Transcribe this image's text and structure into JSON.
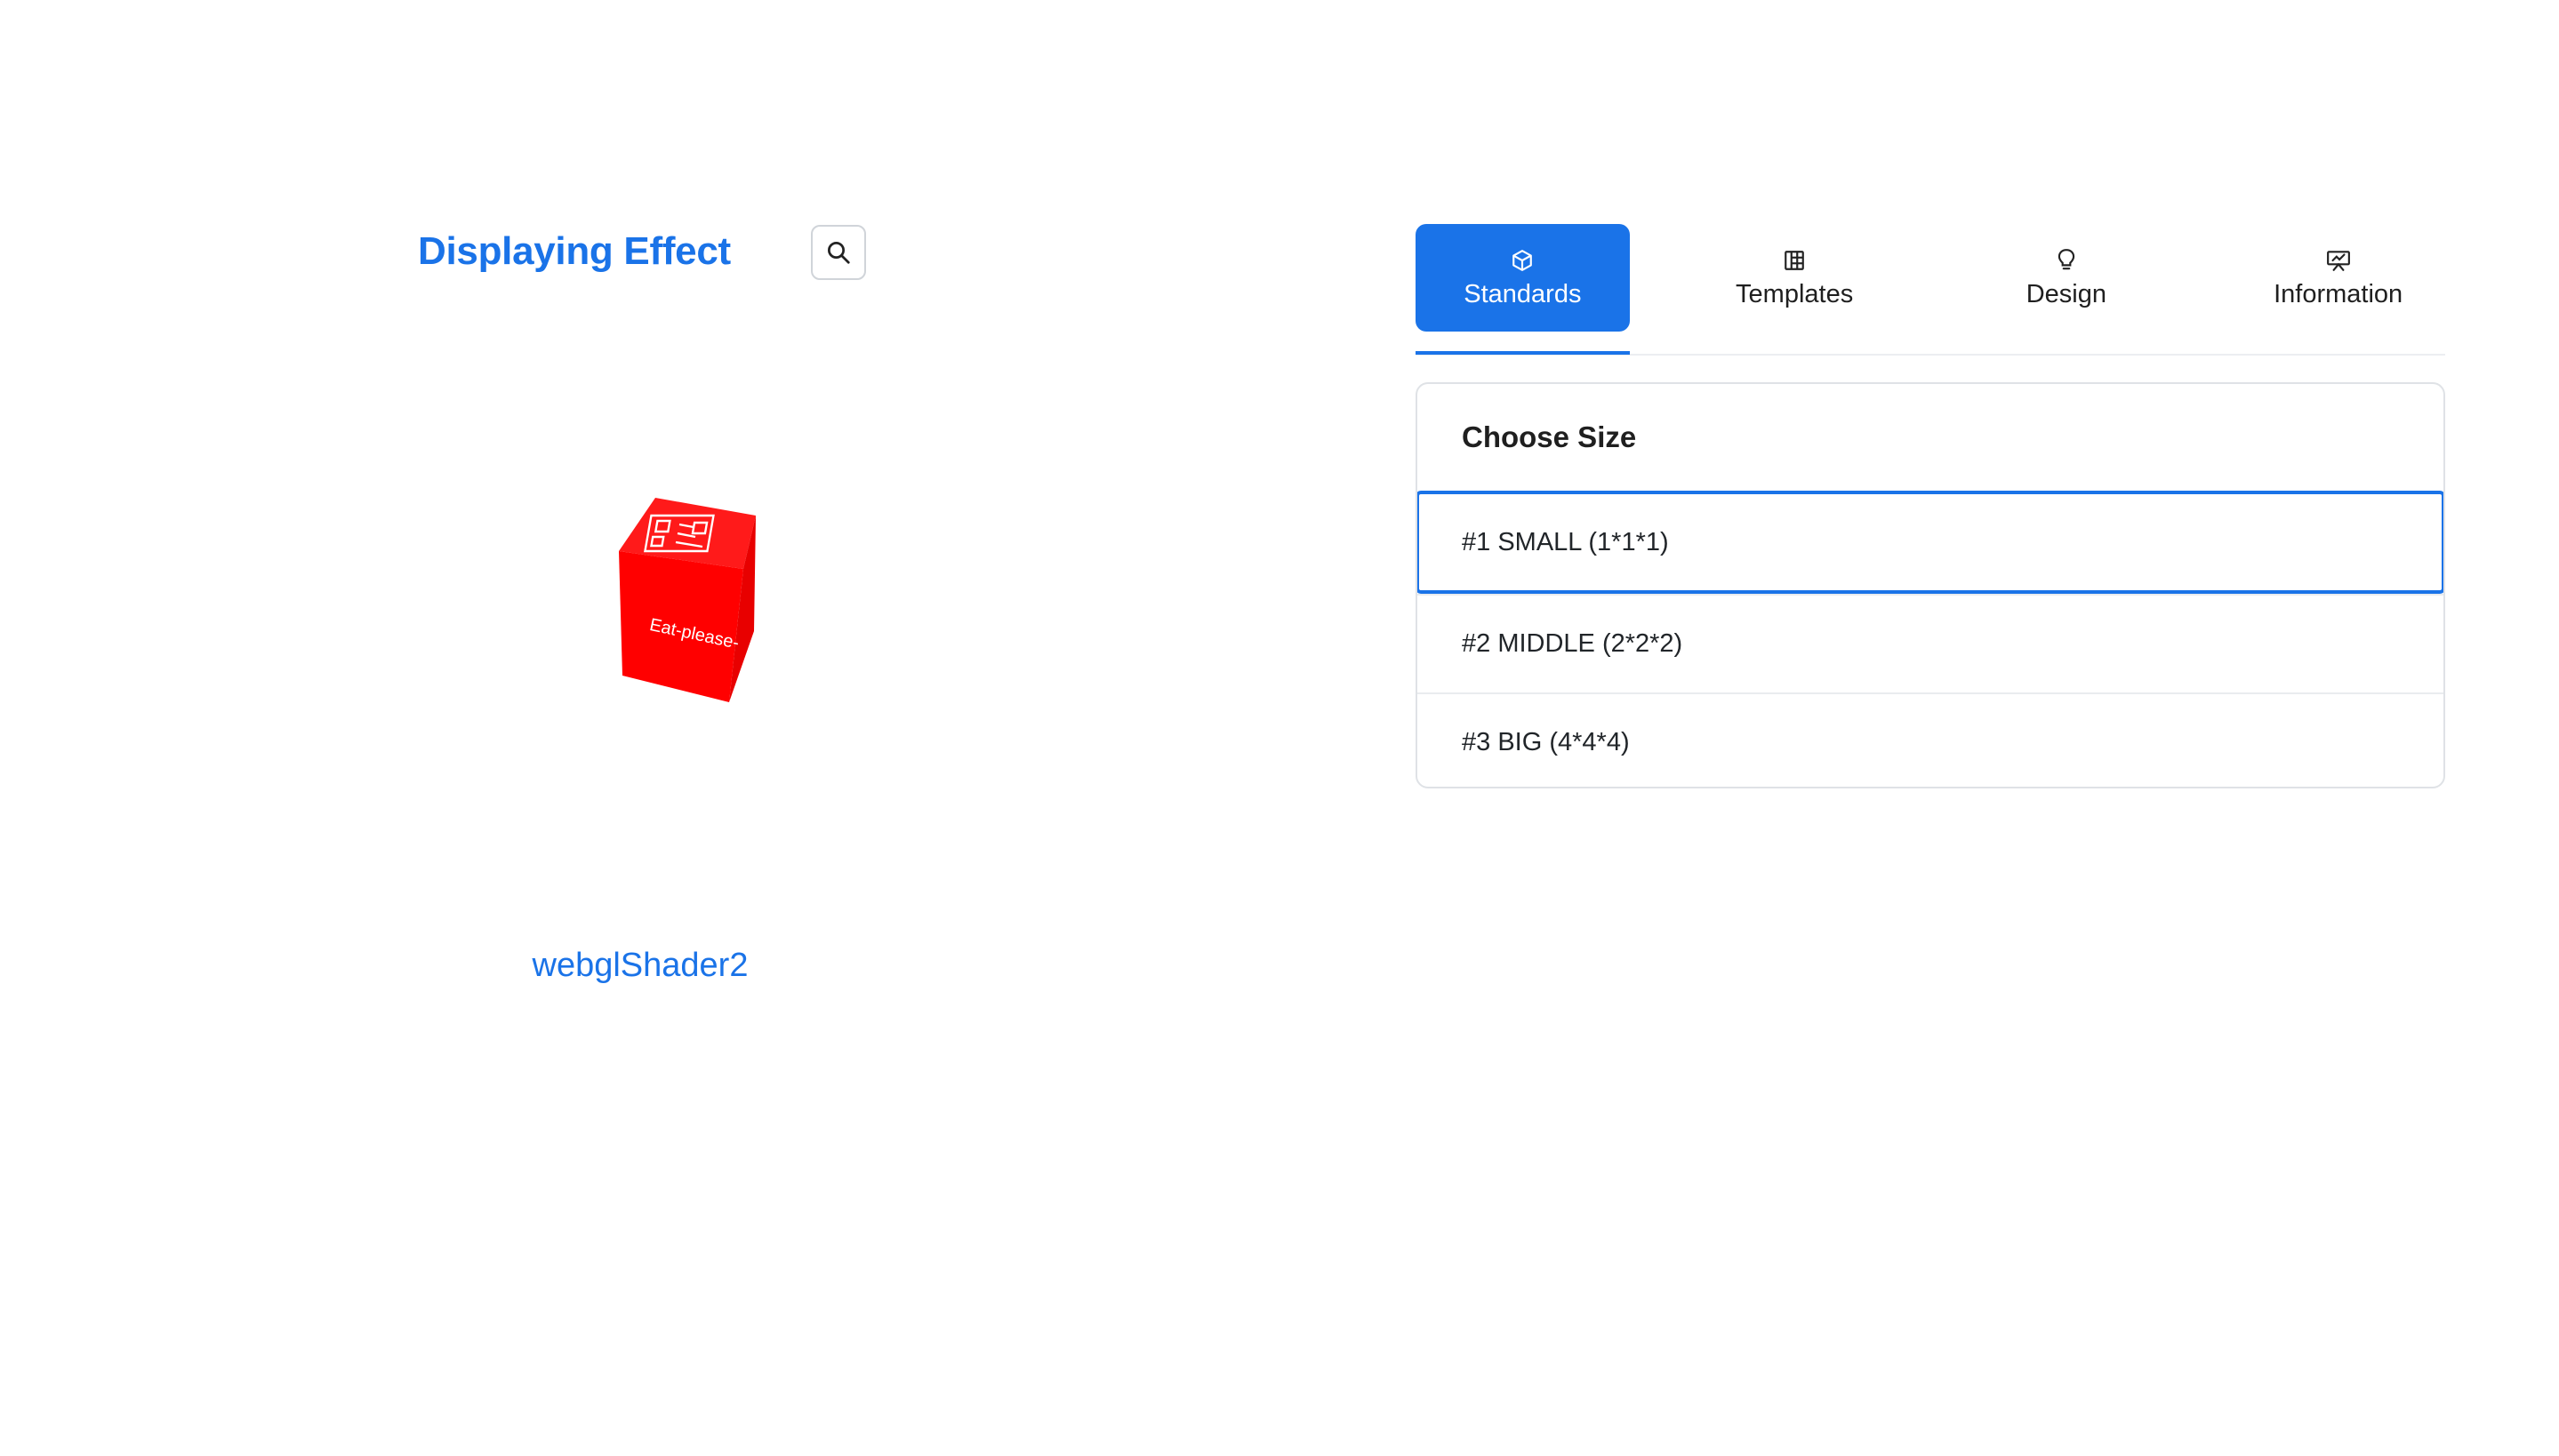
{
  "left_panel": {
    "title": "Displaying Effect",
    "search_icon": "search-icon",
    "cube_front_text": "Eat-please-",
    "caption": "webglShader2",
    "cube_color": "#ff0000"
  },
  "tabs": [
    {
      "label": "Standards",
      "icon": "cube-icon",
      "active": true
    },
    {
      "label": "Templates",
      "icon": "grid-icon",
      "active": false
    },
    {
      "label": "Design",
      "icon": "lightbulb-icon",
      "active": false
    },
    {
      "label": "Information",
      "icon": "presentation-icon",
      "active": false
    }
  ],
  "size_card": {
    "header": "Choose Size",
    "options": [
      {
        "label": "#1 SMALL (1*1*1)",
        "selected": true
      },
      {
        "label": "#2 MIDDLE (2*2*2)",
        "selected": false
      },
      {
        "label": "#3 BIG (4*4*4)",
        "selected": false
      }
    ]
  },
  "colors": {
    "accent": "#1a73e8",
    "border": "#dfe2e6"
  }
}
